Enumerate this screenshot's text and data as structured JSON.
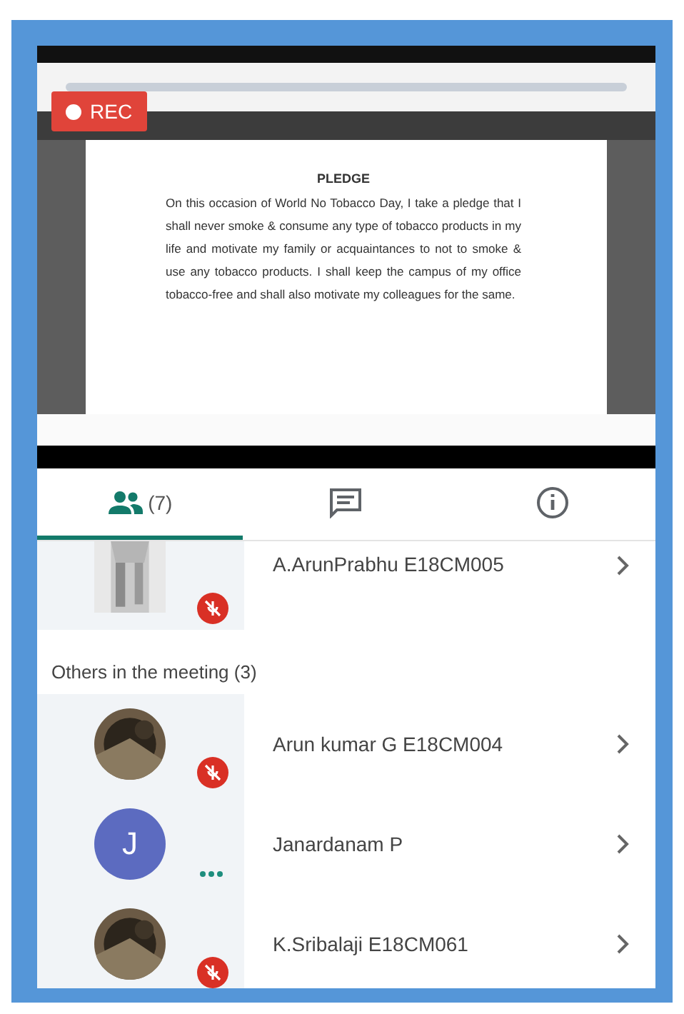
{
  "recording": {
    "label": "REC"
  },
  "document": {
    "heading": "PLEDGE",
    "body": "On this occasion of World No Tobacco Day, I take a pledge that I shall never smoke & consume any type of tobacco products in my life and motivate my family or acquaintances to not to smoke & use any tobacco products. I shall keep the campus of my office tobacco-free and shall also motivate my colleagues for the same."
  },
  "tabs": [
    {
      "kind": "people",
      "count": "(7)",
      "selected": true
    },
    {
      "kind": "chat",
      "selected": false
    },
    {
      "kind": "info",
      "selected": false
    }
  ],
  "pinned": [
    {
      "name": "A.ArunPrabhu E18CM005",
      "mic": {
        "kind": "muted"
      }
    }
  ],
  "others": {
    "heading": "Others in the meeting (3)",
    "participants": [
      {
        "name": "Arun kumar G E18CM004",
        "mic": {
          "kind": "muted"
        }
      },
      {
        "name": "Janardanam P",
        "avatar": {
          "kind": "letter",
          "initial": "J"
        },
        "mic": {
          "kind": "speaking"
        }
      },
      {
        "name": "K.Sribalaji E18CM061",
        "mic": {
          "kind": "muted"
        }
      }
    ]
  }
}
